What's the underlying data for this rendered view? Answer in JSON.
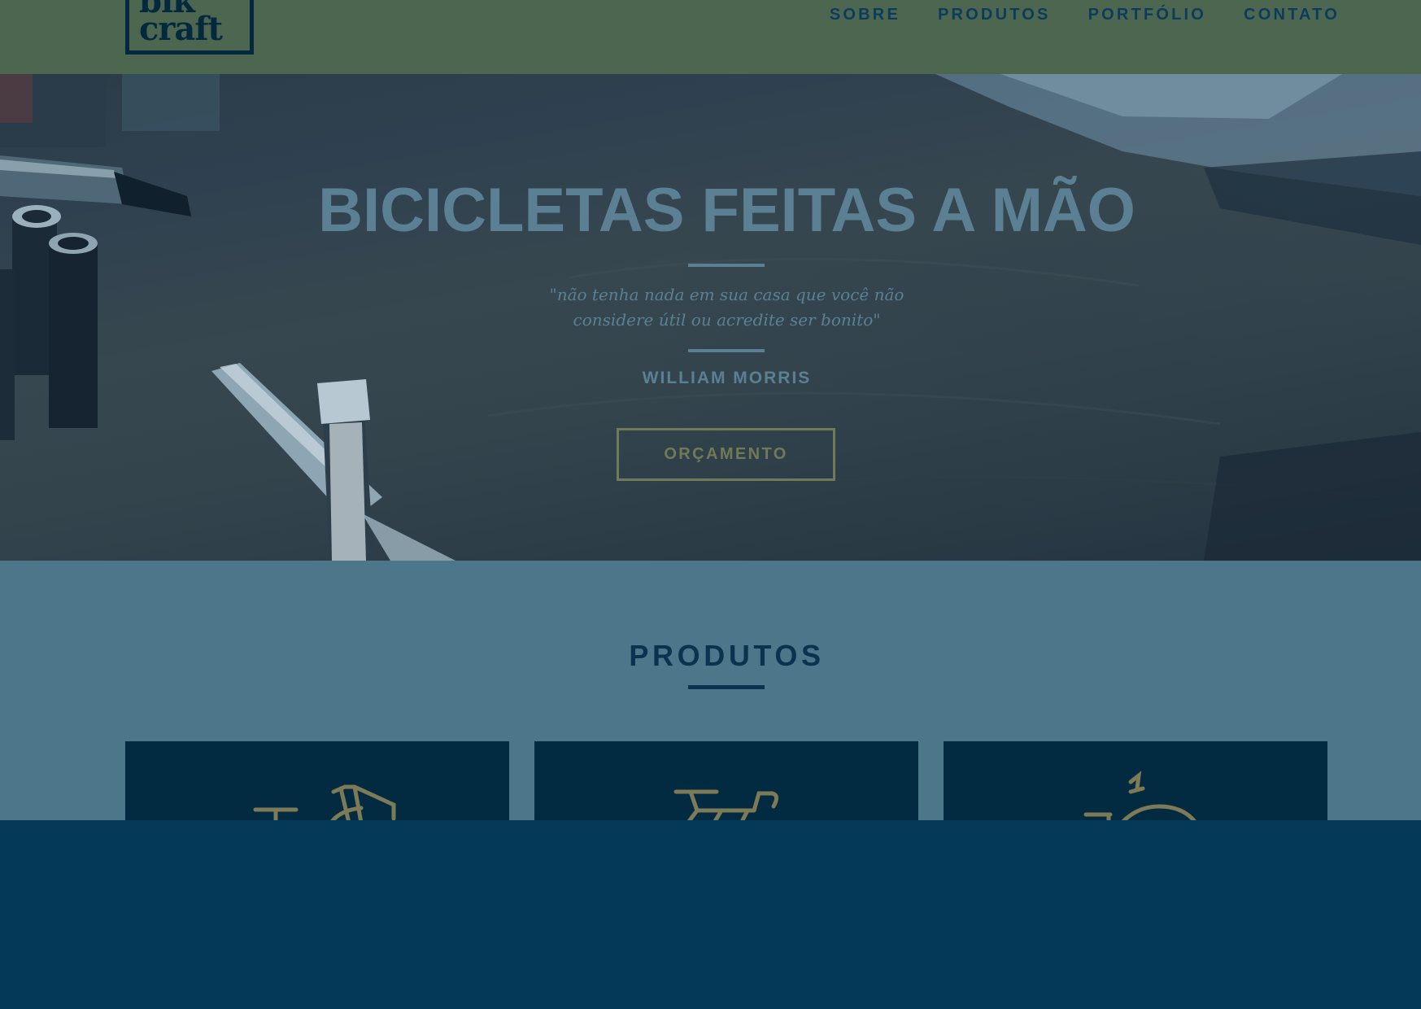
{
  "header": {
    "logo_text": "bikcraft",
    "logo_line1": "bik",
    "logo_line2": "craft",
    "nav": [
      "SOBRE",
      "PRODUTOS",
      "PORTFÓLIO",
      "CONTATO"
    ]
  },
  "hero": {
    "title": "BICICLETAS FEITAS A MÃO",
    "quote_line1": "\"não tenha nada em sua casa que você não",
    "quote_line2": "considere útil ou acredite ser bonito\"",
    "author": "WILLIAM MORRIS",
    "button_label": "ORÇAMENTO"
  },
  "produtos": {
    "title": "PRODUTOS",
    "cards": [
      {
        "icon": "bicycle-basket-icon"
      },
      {
        "icon": "bicycle-icon"
      },
      {
        "icon": "motorbike-icon"
      }
    ]
  },
  "colors": {
    "header_bg": "#4d6650",
    "nav_text": "#0b3b5d",
    "hero_text": "#5b8094",
    "button_accent": "#6f7a56",
    "produtos_bg": "#4c7689",
    "card_bg": "#022a40",
    "icon_color": "#7d7a57",
    "bottom_bg": "#043a58"
  }
}
